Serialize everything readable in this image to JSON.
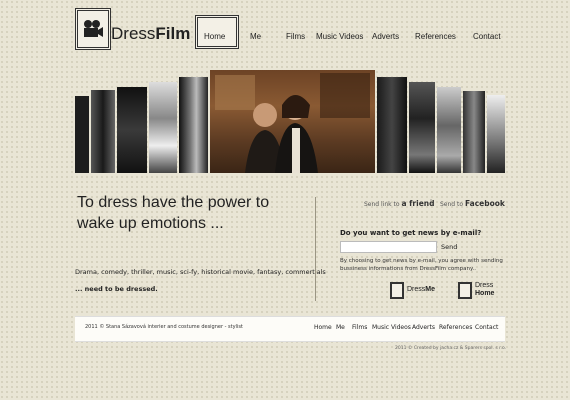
{
  "logo": {
    "brand_light": "Dress",
    "brand_bold": "Film",
    "icon": "film-camera-icon"
  },
  "nav": {
    "items": [
      "Home",
      "Me",
      "Films",
      "Music Videos",
      "Adverts",
      "References",
      "Contact"
    ],
    "active": "Home"
  },
  "banner": {
    "icon": "film-strip-photos"
  },
  "main": {
    "headline_line1": "To dress have the power to",
    "headline_line2": "wake up emotions ...",
    "genres": "Drama, comedy, thriller, music, sci-fy, historical movie, fantasy, commertials",
    "dressed": "... need to be dressed."
  },
  "share": {
    "friend_prefix": "Send link to",
    "friend_bold": "a friend",
    "separator": "|",
    "facebook_prefix": "Send to",
    "facebook_bold": "Facebook"
  },
  "newsletter": {
    "heading": "Do you want to get news by e-mail?",
    "email_value": "",
    "send_label": "Send",
    "disclaimer": "By choosing to get news by e-mail, you agree with sending bussiness informations from DressFilm company.."
  },
  "badges": {
    "me_light": "Dress",
    "me_bold": "Me",
    "home_light": "Dress",
    "home_bold": "Home"
  },
  "footer": {
    "copyright": "2011 © Stana Sázavová interier and costume designer - stylist",
    "nav": [
      "Home",
      "Me",
      "Films",
      "Music Videos",
      "Adverts",
      "References",
      "Contact"
    ],
    "created": "2011 © Created by jacha.cz & Sparers spol. s r.o."
  },
  "colors": {
    "background": "#e9e5d5",
    "footer_bg": "#fdfcf8",
    "text": "#222222"
  }
}
